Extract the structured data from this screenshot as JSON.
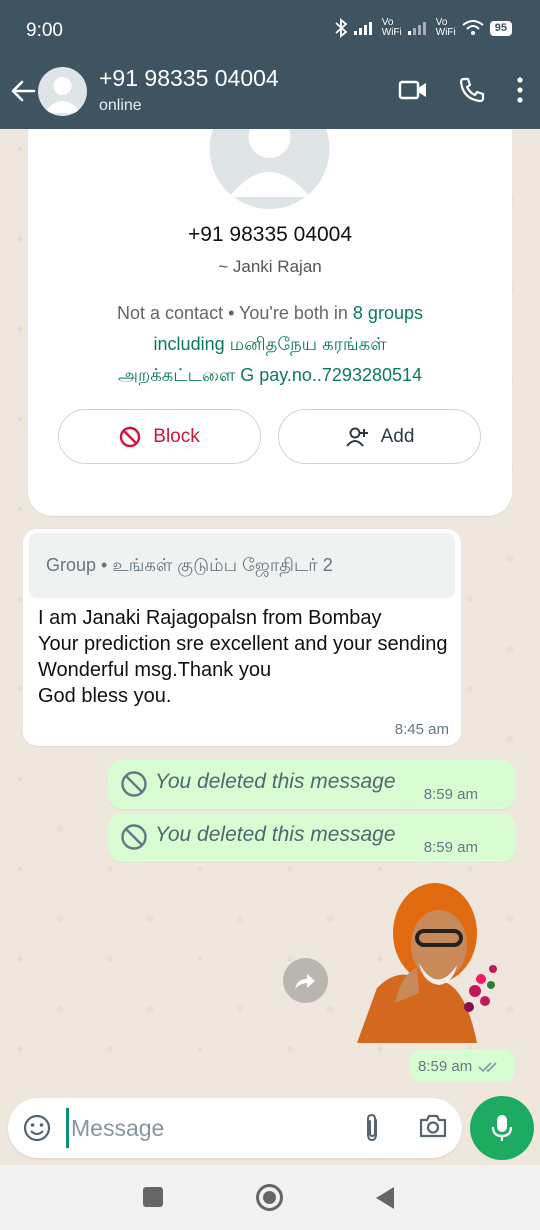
{
  "status_bar": {
    "time": "9:00",
    "battery": "95",
    "signal1": "Vo WiFi",
    "signal2": "Vo WiFi"
  },
  "header": {
    "title": "+91 98335 04004",
    "subtitle": "online"
  },
  "contact_card": {
    "number": "+91 98335 04004",
    "alias": "~ Janki Rajan",
    "info_prefix": "Not a contact • You're both in ",
    "groups_link": "8 groups",
    "line2": "including மனிதநேய கரங்கள்",
    "line3": "அறக்கட்டளை G pay.no..7293280514",
    "block_label": "Block",
    "add_label": "Add"
  },
  "messages": {
    "incoming": {
      "quote": "Group • உங்கள் குடும்ப ஜோதிடர் 2",
      "text": "I am Janaki Rajagopalsn from Bombay\nYour prediction  sre excellent and your sending\nWonderful  msg.Thank you\nGod bless you.",
      "time": "8:45 am"
    },
    "deleted": [
      {
        "text": "You deleted this message",
        "time": "8:59 am"
      },
      {
        "text": "You deleted this message",
        "time": "8:59 am"
      }
    ],
    "sticker": {
      "time": "8:59 am"
    }
  },
  "composer": {
    "placeholder": "Message"
  },
  "colors": {
    "header": "#3e5461",
    "outgoing": "#d9fdd3",
    "accent": "#1daa61",
    "block": "#d0143a"
  }
}
